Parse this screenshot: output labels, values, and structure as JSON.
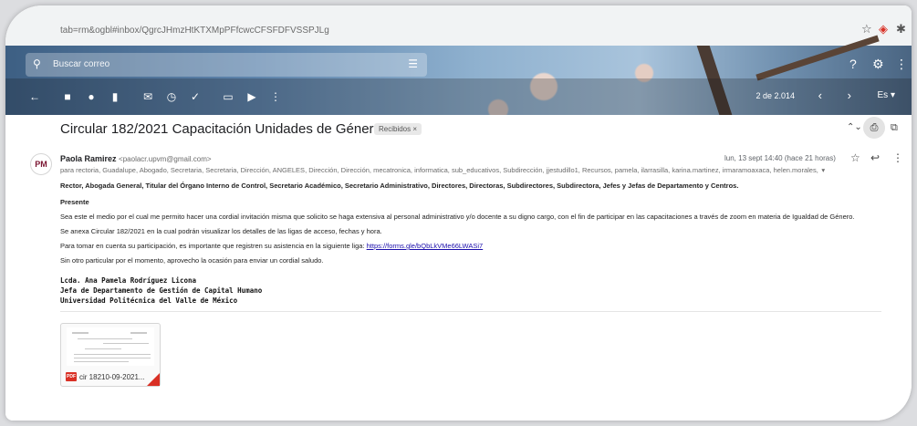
{
  "browser": {
    "url": "tab=rm&ogbl#inbox/QgrcJHmzHtKTXMpPFfcwcCFSFDFVSSPJLg",
    "icons": [
      "star-icon",
      "extension-icon",
      "puzzle-icon"
    ]
  },
  "header": {
    "search_placeholder": "Buscar correo",
    "icons": [
      "search-icon",
      "filter-icon",
      "help-icon",
      "settings-icon",
      "apps-icon"
    ]
  },
  "toolbar": {
    "page_info": "2 de 2.014",
    "lang": "Es",
    "icons": [
      "back-icon",
      "archive-icon",
      "report-icon",
      "delete-icon",
      "mark-unread-icon",
      "snooze-icon",
      "add-task-icon",
      "move-to-icon",
      "label-icon",
      "more-icon"
    ]
  },
  "email": {
    "subject": "Circular 182/2021 Capacitación Unidades de Género",
    "label": "Recibidos ×",
    "sender_name": "Paola Ramirez",
    "sender_email": "<paolacr.upvm@gmail.com>",
    "avatar_text": "PM",
    "recipients": "para rectoria, Guadalupe, Abogado, Secretaria, Secretaria, Dirección, ANGELES, Dirección, Dirección, mecatronica, informatica, sub_educativos, Subdirección, jjestudillo1, Recursos, pamela, ilarrasilla, karina.martinez, irmaramoaxaca, helen.morales,  ▾",
    "date": "lun, 13 sept 14:40 (hace 21 horas)",
    "greeting": "Rector, Abogada General, Titular del Órgano Interno de Control, Secretario Académico, Secretario Administrativo, Directores, Directoras, Subdirectores, Subdirectora, Jefes y Jefas de Departamento y Centros.",
    "presente": "Presente",
    "p1": "Sea este el medio por el cual me permito hacer una cordial invitación misma que solicito se haga extensiva al personal administrativo y/o docente a su digno cargo, con el fin de participar en las capacitaciones a través de zoom en materia de Igualdad de Género.",
    "p2": "Se anexa Circular 182/2021 en la cual podrán visualizar los detalles de las ligas de acceso, fechas y hora.",
    "p3": "Para tomar en cuenta su participación, es importante que registren su asistencia en la siguiente liga:",
    "link": "https://forms.gle/bQbLkVMe66LWASi7",
    "p4": "Sin otro particular por el momento, aprovecho la ocasión para enviar un cordial saludo.",
    "sig1": "Lcda. Ana Pamela Rodríguez Licona",
    "sig2": "Jefa de Departamento de Gestión de Capital Humano",
    "sig3": "Universidad Politécnica del Valle de México",
    "attachment_name": "cir 18210-09-2021...",
    "attachment_type": "PDF"
  }
}
